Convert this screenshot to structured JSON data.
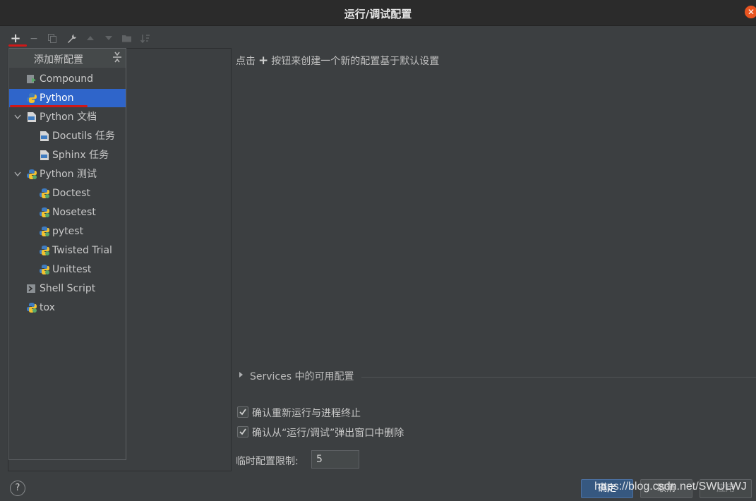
{
  "window": {
    "title": "运行/调试配置"
  },
  "toolbar": {
    "add": "+",
    "remove": "−"
  },
  "popup": {
    "title": "添加新配置",
    "items": [
      {
        "label": "Compound",
        "icon": "compound-icon"
      },
      {
        "label": "Python",
        "icon": "python-icon",
        "selected": true
      },
      {
        "label": "Python 文档",
        "icon": "rst-doc-icon",
        "expanded": true
      },
      {
        "label": "Docutils 任务",
        "icon": "rst-doc-icon"
      },
      {
        "label": "Sphinx 任务",
        "icon": "rst-doc-icon"
      },
      {
        "label": "Python 测试",
        "icon": "python-test-icon",
        "expanded": true
      },
      {
        "label": "Doctest",
        "icon": "python-test-icon"
      },
      {
        "label": "Nosetest",
        "icon": "python-test-icon"
      },
      {
        "label": "pytest",
        "icon": "python-test-icon"
      },
      {
        "label": "Twisted Trial",
        "icon": "python-test-icon"
      },
      {
        "label": "Unittest",
        "icon": "python-test-icon"
      },
      {
        "label": "Shell Script",
        "icon": "shell-script-icon"
      },
      {
        "label": "tox",
        "icon": "python-test-icon"
      }
    ]
  },
  "main": {
    "hint_before": "点击",
    "hint_plus": "+",
    "hint_after": "按钮来创建一个新的配置基于默认设置",
    "services_label": "Services 中的可用配置",
    "confirm_rerun": "确认重新运行与进程终止",
    "confirm_delete": "确认从“运行/调试”弹出窗口中删除",
    "temp_limit_label": "临时配置限制:",
    "temp_limit_value": "5"
  },
  "footer": {
    "help": "?",
    "ok": "确定",
    "cancel": "取消",
    "apply": "应用",
    "watermark": "https://blog.csdn.net/SWULWJ"
  },
  "colors": {
    "background": "#3c3f41",
    "selection": "#2f65ca",
    "annotation_red": "#d01818",
    "close_button": "#e95420"
  }
}
